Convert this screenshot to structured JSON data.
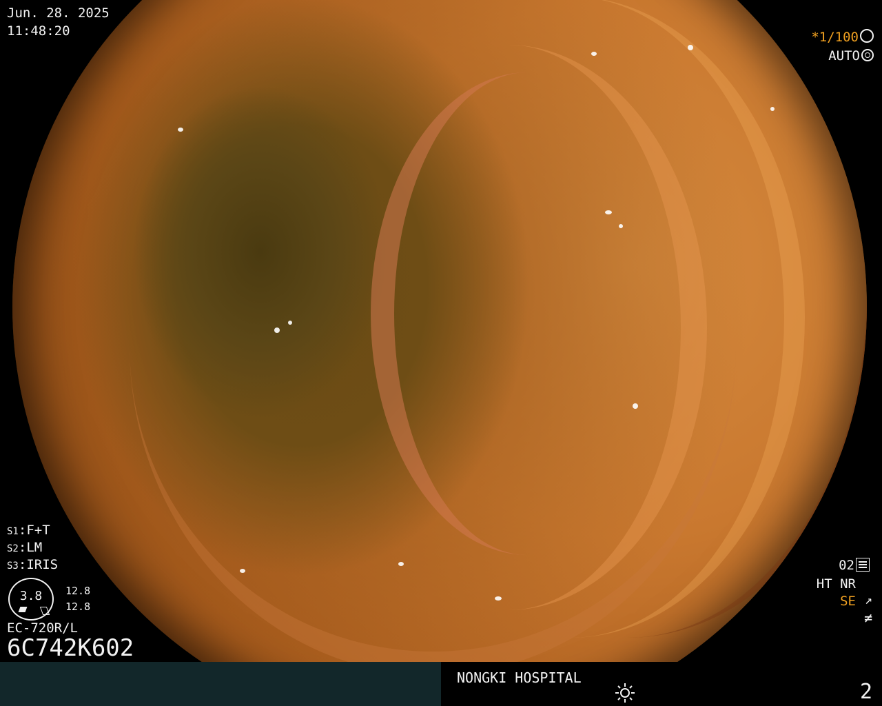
{
  "header": {
    "date": "Jun. 28. 2025",
    "time": "11:48:20"
  },
  "camera": {
    "shutter": "*1/100",
    "shutter_icon": "aperture-icon",
    "iris_mode": "AUTO",
    "iris_icon": "iris-icon"
  },
  "switches": [
    {
      "key": "S1",
      "label": "F+T"
    },
    {
      "key": "S2",
      "label": "LM"
    },
    {
      "key": "S3",
      "label": "IRIS"
    }
  ],
  "dial": {
    "value": "3.8",
    "upper": "12.8",
    "lower": "12.8"
  },
  "scope": {
    "model": "EC-720R/L",
    "serial": "6C742K602"
  },
  "status": {
    "o2": "02",
    "ht_nr": "HT NR",
    "se": "SE",
    "se_color": "#f0a020"
  },
  "footer": {
    "hospital": "NONGKI HOSPITAL",
    "page": "2",
    "bar_color": "#12272a"
  }
}
